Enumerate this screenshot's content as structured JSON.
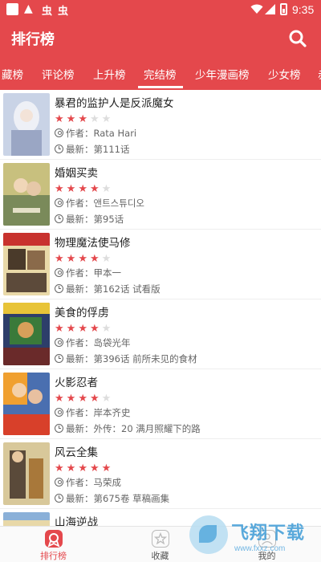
{
  "status_bar": {
    "warning_glyph": "▲",
    "app_glyph_1": "虫",
    "app_glyph_2": "虫",
    "time": "9:35"
  },
  "header": {
    "title": "排行榜"
  },
  "tabs": [
    {
      "label": "藏榜"
    },
    {
      "label": "评论榜"
    },
    {
      "label": "上升榜"
    },
    {
      "label": "完结榜",
      "active": true
    },
    {
      "label": "少年漫画榜"
    },
    {
      "label": "少女榜"
    },
    {
      "label": "赤"
    }
  ],
  "author_prefix": "作者：",
  "latest_prefix": "最新：",
  "colors": {
    "accent": "#e4484c",
    "star_on": "#e4484c",
    "star_off": "#dddddd"
  },
  "comics": [
    {
      "title": "暴君的监护人是反派魔女",
      "rating": 3,
      "author": "Rata Hari",
      "latest": "第111话"
    },
    {
      "title": "婚姻买卖",
      "rating": 4,
      "author": "앤트스튜디오",
      "latest": "第95话"
    },
    {
      "title": "物理魔法使马修",
      "rating": 4,
      "author": "甲本一",
      "latest": "第162话 试看版"
    },
    {
      "title": "美食的俘虏",
      "rating": 4,
      "author": "岛袋光年",
      "latest": "第396话 前所未见的食材"
    },
    {
      "title": "火影忍者",
      "rating": 4,
      "author": "岸本齐史",
      "latest": "外传：20 满月照耀下的路"
    },
    {
      "title": "风云全集",
      "rating": 5,
      "author": "马荣成",
      "latest": "第675卷 草稿画集"
    },
    {
      "title": "山海逆战",
      "rating": 0,
      "author": "",
      "latest": ""
    }
  ],
  "bottom_nav": [
    {
      "label": "排行榜",
      "icon": "ranking-icon",
      "active": true
    },
    {
      "label": "收藏",
      "icon": "favorites-icon"
    },
    {
      "label": "我的",
      "icon": "profile-icon"
    }
  ],
  "watermark": {
    "text": "飞翔下载",
    "url": "www.fxxz.com"
  }
}
